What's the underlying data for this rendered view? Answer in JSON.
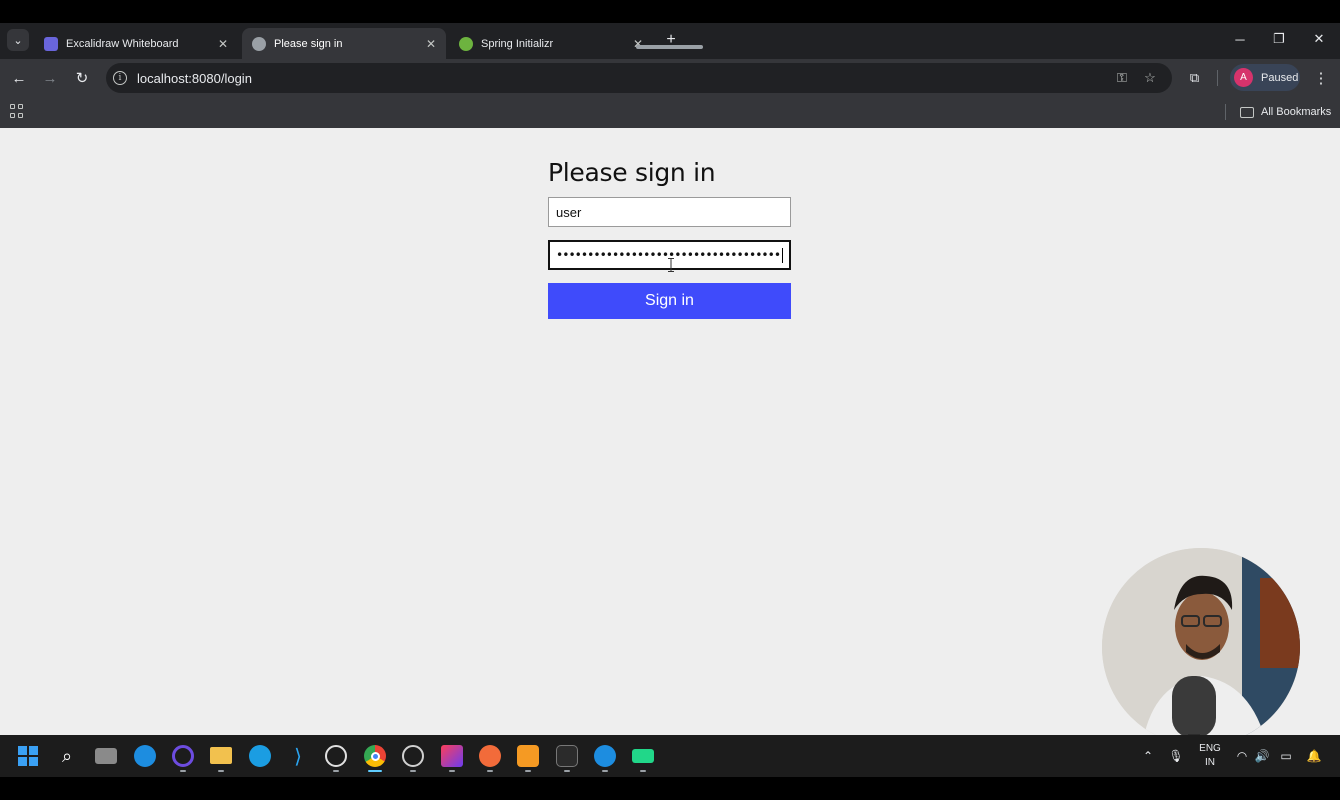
{
  "browser": {
    "tabs": [
      {
        "title": "Excalidraw Whiteboard",
        "active": false,
        "favicon": "excalidraw-icon",
        "favicon_color": "#6965db"
      },
      {
        "title": "Please sign in",
        "active": true,
        "favicon": "globe-icon",
        "favicon_color": "#9aa0a6"
      },
      {
        "title": "Spring Initializr",
        "active": false,
        "favicon": "spring-icon",
        "favicon_color": "#6db33f"
      }
    ],
    "new_tab_label": "+",
    "address": "localhost:8080/login",
    "profile": {
      "initial": "A",
      "status": "Paused",
      "avatar_color": "#d6336c"
    },
    "bookmarks_label": "All Bookmarks"
  },
  "login": {
    "heading": "Please sign in",
    "username_value": "user",
    "password_mask": "••••••••••••••••••••••••••••••••••••",
    "submit_label": "Sign in",
    "submit_color": "#3f4bfb"
  },
  "taskbar": {
    "language_line1": "ENG",
    "language_line2": "IN",
    "apps": [
      "start-icon",
      "search-icon",
      "task-view-icon",
      "docker-icon",
      "cortana-icon",
      "file-explorer-icon",
      "edge-icon",
      "vscode-icon",
      "chatgpt-icon",
      "chrome-icon",
      "obs-icon",
      "intellij-icon",
      "postman-icon",
      "sublime-icon",
      "terminal-icon",
      "docker-desktop-icon",
      "pycharm-icon"
    ]
  }
}
